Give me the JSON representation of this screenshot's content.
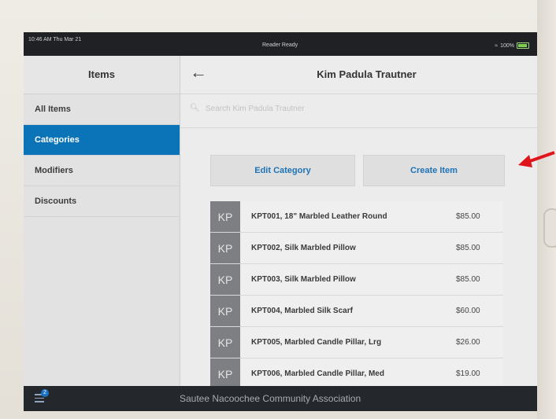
{
  "status_bar": {
    "time": "10:46 AM  Thu Mar 21",
    "reader_status": "Reader Ready",
    "battery": "100%"
  },
  "sidebar": {
    "title": "Items",
    "items": [
      {
        "label": "All Items"
      },
      {
        "label": "Categories",
        "active": true
      },
      {
        "label": "Modifiers"
      },
      {
        "label": "Discounts"
      }
    ]
  },
  "main": {
    "title": "Kim Padula Trautner",
    "search_placeholder": "Search Kim Padula Trautner",
    "edit_category_label": "Edit Category",
    "create_item_label": "Create Item",
    "items": [
      {
        "initials": "KP",
        "name": "KPT001, 18\" Marbled Leather Round",
        "price": "$85.00"
      },
      {
        "initials": "KP",
        "name": "KPT002, Silk Marbled Pillow",
        "price": "$85.00"
      },
      {
        "initials": "KP",
        "name": "KPT003, Silk Marbled Pillow",
        "price": "$85.00"
      },
      {
        "initials": "KP",
        "name": "KPT004, Marbled Silk Scarf",
        "price": "$60.00"
      },
      {
        "initials": "KP",
        "name": "KPT005, Marbled Candle Pillar, Lrg",
        "price": "$26.00"
      },
      {
        "initials": "KP",
        "name": "KPT006, Marbled Candle Pillar, Med",
        "price": "$19.00"
      }
    ]
  },
  "footer": {
    "organization": "Sautee Nacoochee Community Association",
    "notification_count": "2"
  },
  "colors": {
    "accent": "#0b73b8",
    "annotation_arrow": "#e0141b"
  }
}
